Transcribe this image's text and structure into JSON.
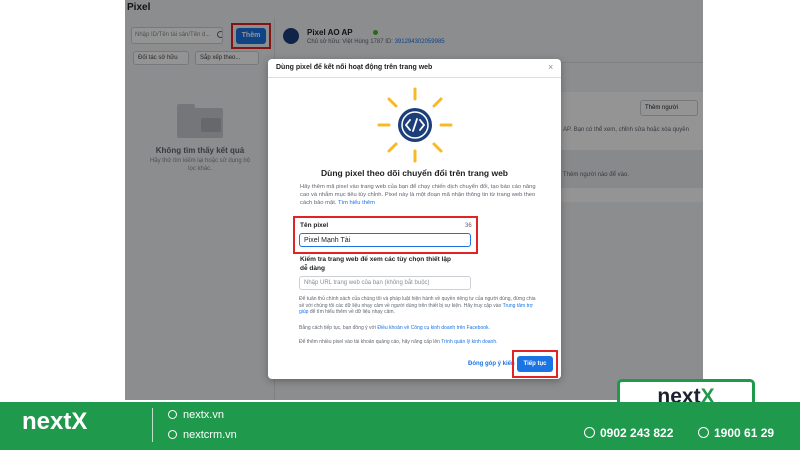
{
  "app": {
    "title": "Pixel",
    "search": {
      "placeholder": "Nhập ID/Tên tài sản/Tên d..."
    },
    "add_button": "Thêm",
    "filters": [
      "Đối tác sở hữu",
      "Sắp xếp theo..."
    ],
    "empty": {
      "title": "Không tìm thấy kết quả",
      "hint": "Hãy thử tìm kiếm lại hoặc sử dụng bộ lọc khác."
    },
    "pixel": {
      "name": "Pixel AO AP",
      "owner_prefix": "Chủ sở hữu: Việt Hùng 1787  ID:",
      "owner_id": "391294302059985"
    },
    "right_panel": {
      "add_person": "Thêm người",
      "text1": "AP. Bạn có thể xem, chỉnh sửa hoặc xóa quyền",
      "text2": "Thêm người nào để vào."
    }
  },
  "modal": {
    "title": "Dùng pixel để kết nối hoạt động trên trang web",
    "close": "×",
    "heading": "Dùng pixel theo dõi chuyển đổi trên trang web",
    "description": "Hãy thêm mã pixel vào trang web của bạn để chạy chiến dịch chuyển đổi, tạo báo cáo nâng cao và nhắm mục tiêu tùy chỉnh. Pixel này là một đoạn mã nhận thông tin từ trang web theo cách bảo mật.",
    "description_link": "Tìm hiểu thêm",
    "name_field": {
      "label": "Tên pixel",
      "counter": "36",
      "value": "Pixel Mạnh Tài"
    },
    "check_label": "Kiểm tra trang web để xem các tùy chọn thiết lập dễ dàng",
    "url_placeholder": "Nhập URL trang web của bạn (không bắt buộc)",
    "fine1": "Để tuân thủ chính sách của chúng tôi và pháp luật hiện hành về quyền riêng tư của người dùng, đừng chia sẻ với chúng tôi các dữ liệu nhạy cảm về người dùng trên thiết bị sự kiện. Hãy truy cập vào",
    "fine1_link": "Trung tâm trợ giúp",
    "fine1_tail": "để tìm hiểu thêm về dữ liệu nhạy cảm.",
    "fine2": "Bằng cách tiếp tục, bạn đồng ý với",
    "fine2_link": "Điều khoản về Công cụ kinh doanh trên Facebook.",
    "fine3": "Để thêm nhiều pixel vào tài khoản quảng cáo, hãy nâng cấp lên",
    "fine3_link": "Trình quản lý kinh doanh.",
    "feedback": "Đóng góp ý kiến",
    "continue": "Tiếp tục"
  },
  "brand": {
    "logo_a": "next",
    "logo_b": "X",
    "site1": "nextx.vn",
    "site2": "nextcrm.vn",
    "phone1": "0902 243 822",
    "phone2": "1900 61 29",
    "color_green": "#1f9a4c"
  }
}
